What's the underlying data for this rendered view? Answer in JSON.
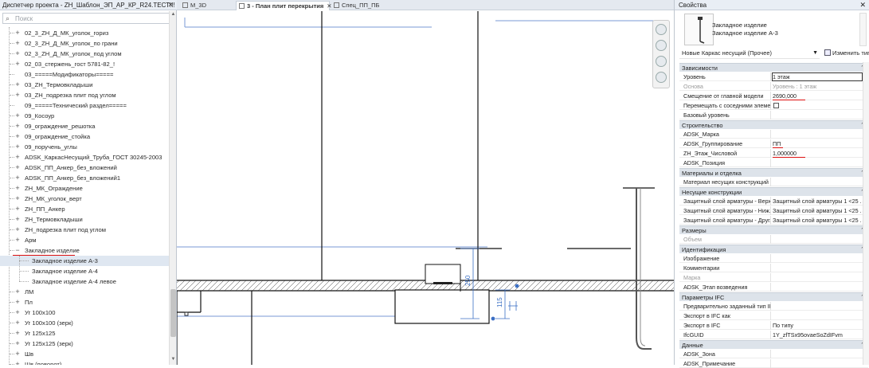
{
  "project_browser": {
    "title": "Диспетчер проекта - ZH_Шаблон_ЭП_АР_КР_R24.ТЕСТ!!!",
    "close": "✕",
    "search_placeholder": "Поиск",
    "items": [
      {
        "label": "02_3_ZH_Д_МК_уголок_гориз",
        "expander": "+",
        "level": 1
      },
      {
        "label": "02_3_ZH_Д_МК_уголок_по грани",
        "expander": "+",
        "level": 1
      },
      {
        "label": "02_3_ZH_Д_МК_уголок_под углом",
        "expander": "+",
        "level": 1
      },
      {
        "label": "02_03_стержень_гост 5781-82_!",
        "expander": "+",
        "level": 1
      },
      {
        "label": "03_=====Модификаторы=====",
        "expander": "",
        "level": 1
      },
      {
        "label": "03_ZH_Термовкладыши",
        "expander": "+",
        "level": 1
      },
      {
        "label": "03_ZH_подрезка плит под углом",
        "expander": "+",
        "level": 1
      },
      {
        "label": "09_=====Технический раздел=====",
        "expander": "",
        "level": 1
      },
      {
        "label": "09_Косоур",
        "expander": "+",
        "level": 1
      },
      {
        "label": "09_ограждение_решотка",
        "expander": "+",
        "level": 1
      },
      {
        "label": "09_ограждение_стойка",
        "expander": "+",
        "level": 1
      },
      {
        "label": "09_поручень_углы",
        "expander": "+",
        "level": 1
      },
      {
        "label": "ADSK_КаркасНесущий_Труба_ГОСТ 30245-2003",
        "expander": "+",
        "level": 1
      },
      {
        "label": "ADSK_ПП_Анкер_без_вложений",
        "expander": "+",
        "level": 1
      },
      {
        "label": "ADSK_ПП_Анкер_без_вложений1",
        "expander": "+",
        "level": 1
      },
      {
        "label": "ZH_МК_Ограждение",
        "expander": "+",
        "level": 1
      },
      {
        "label": "ZH_МК_уголок_верт",
        "expander": "+",
        "level": 1
      },
      {
        "label": "ZH_ПП_Анкер",
        "expander": "+",
        "level": 1
      },
      {
        "label": "ZH_Термовкладыши",
        "expander": "+",
        "level": 1
      },
      {
        "label": "ZH_подрезка плит под углом",
        "expander": "+",
        "level": 1
      },
      {
        "label": "Арм",
        "expander": "+",
        "level": 1
      },
      {
        "label": "Закладное изделие",
        "expander": "−",
        "level": 1
      },
      {
        "label": "Закладное изделие А-3",
        "expander": "",
        "level": 2
      },
      {
        "label": "Закладное изделие А-4",
        "expander": "",
        "level": 2
      },
      {
        "label": "Закладное изделие А-4 левое",
        "expander": "",
        "level": 2
      },
      {
        "label": "ЛМ",
        "expander": "+",
        "level": 1
      },
      {
        "label": "Пл",
        "expander": "+",
        "level": 1
      },
      {
        "label": "Уг 100x100",
        "expander": "+",
        "level": 1
      },
      {
        "label": "Уг 100x100 (зерк)",
        "expander": "+",
        "level": 1
      },
      {
        "label": "Уг 125x125",
        "expander": "+",
        "level": 1
      },
      {
        "label": "Уг 125x125 (зерк)",
        "expander": "+",
        "level": 1
      },
      {
        "label": "Шв",
        "expander": "+",
        "level": 1
      },
      {
        "label": "Шв (поворот)",
        "expander": "+",
        "level": 1
      }
    ]
  },
  "tabs": [
    {
      "label": "М_3D",
      "active": false,
      "close": ""
    },
    {
      "label": "3 - План плит перекрытия",
      "active": true,
      "close": "✕"
    },
    {
      "label": "Спец_ПП_ПБ",
      "active": false,
      "close": ""
    }
  ],
  "canvas": {
    "dim_250": "250",
    "dim_115": "115"
  },
  "properties": {
    "title": "Свойства",
    "close": "✕",
    "type_name_line1": "Закладное изделие",
    "type_name_line2": "Закладное изделие А-3",
    "instance_filter": "Новые Каркас несущий (Прочее)",
    "edit_type_label": "Изменить тип",
    "sections": [
      {
        "title": "Зависимости",
        "rows": [
          {
            "key": "Уровень",
            "value": "1 этаж",
            "boxed": true
          },
          {
            "key": "Основа",
            "value": "Уровень : 1 этаж",
            "dim": true
          },
          {
            "key": "Смещение от главной модели",
            "value": "2690,000",
            "underline": true
          },
          {
            "key": "Перемещать с соседними элеме...",
            "value": "",
            "checkbox": true
          },
          {
            "key": "Базовый уровень",
            "value": ""
          }
        ]
      },
      {
        "title": "Строительство",
        "rows": [
          {
            "key": "ADSK_Марка",
            "value": ""
          },
          {
            "key": "ADSK_Группирование",
            "value": "ПП",
            "underline": true
          },
          {
            "key": "ZH_Этаж_Числовой",
            "value": "1,000000",
            "underline": true
          },
          {
            "key": "ADSK_Позиция",
            "value": ""
          }
        ]
      },
      {
        "title": "Материалы и отделка",
        "rows": [
          {
            "key": "Материал несущих конструкций",
            "value": ""
          }
        ]
      },
      {
        "title": "Несущие конструкции",
        "rows": [
          {
            "key": "Защитный слой арматуры - Верх...",
            "value": "Защитный слой арматуры 1 <25 ...",
            "dots": true
          },
          {
            "key": "Защитный слой арматуры - Ниж...",
            "value": "Защитный слой арматуры 1 <25 ...",
            "dots": true
          },
          {
            "key": "Защитный слой арматуры - Друг...",
            "value": "Защитный слой арматуры 1 <25 ...",
            "dots": true
          }
        ]
      },
      {
        "title": "Размеры",
        "rows": [
          {
            "key": "Объем",
            "value": "",
            "dimkey": true
          }
        ]
      },
      {
        "title": "Идентификация",
        "rows": [
          {
            "key": "Изображение",
            "value": ""
          },
          {
            "key": "Комментарии",
            "value": ""
          },
          {
            "key": "Марка",
            "value": "",
            "dimkey": true
          },
          {
            "key": "ADSK_Этап возведения",
            "value": ""
          }
        ]
      },
      {
        "title": "Параметры IFC",
        "rows": [
          {
            "key": "Предварительно заданный тип IFC",
            "value": ""
          },
          {
            "key": "Экспорт в IFC как",
            "value": ""
          },
          {
            "key": "Экспорт в IFC",
            "value": "По типу"
          },
          {
            "key": "IfcGUID",
            "value": "1Y_zfTSx95ovaeSoZdIFvm"
          }
        ]
      },
      {
        "title": "Данные",
        "rows": [
          {
            "key": "ADSK_Зона",
            "value": ""
          },
          {
            "key": "ADSK_Примечание",
            "value": ""
          }
        ]
      }
    ],
    "collapse_chevron": "⌃"
  },
  "colors": {
    "annotation_red": "#d11111",
    "dimension_blue": "#3b6fc4",
    "selection_bg": "#dfe7f1"
  }
}
